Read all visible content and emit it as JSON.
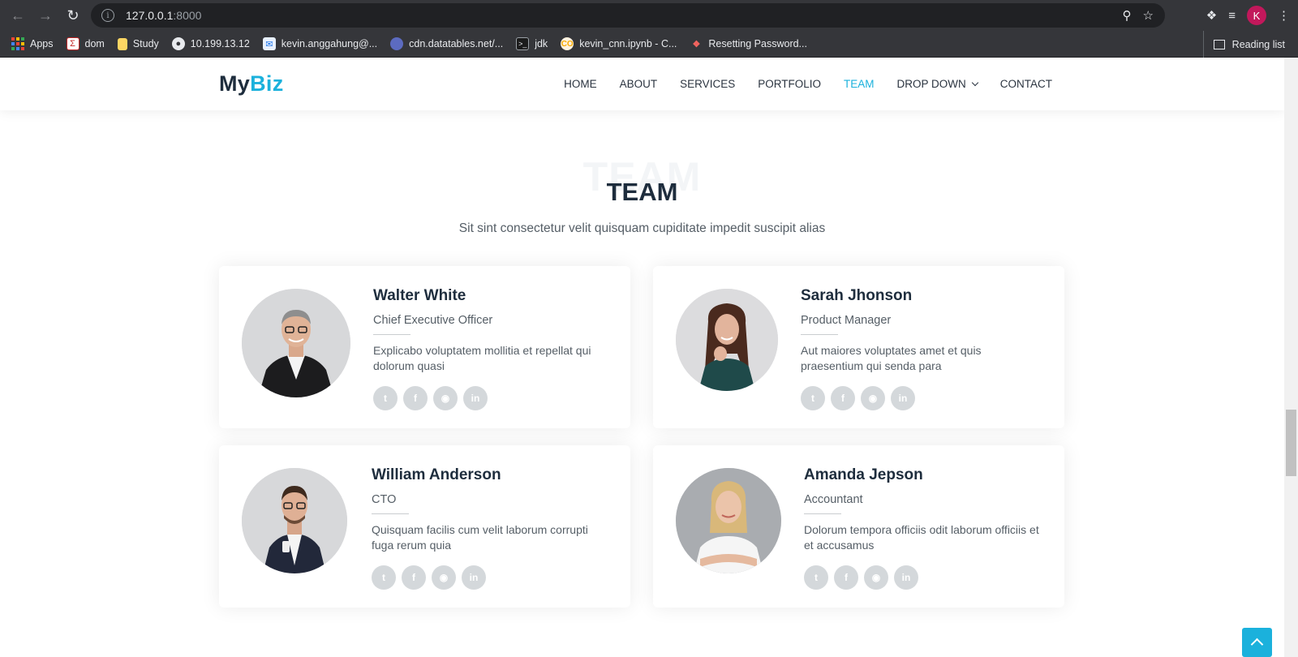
{
  "browser": {
    "url_host": "127.0.0.1",
    "url_port": ":8000",
    "profile_initial": "K",
    "bookmarks": [
      {
        "label": "Apps",
        "icon": "apps-grid-icon"
      },
      {
        "label": "dom",
        "icon": "sigma-icon"
      },
      {
        "label": "Study",
        "icon": "folder-icon"
      },
      {
        "label": "10.199.13.12",
        "icon": "globe-icon"
      },
      {
        "label": "kevin.anggahung@...",
        "icon": "mail-icon"
      },
      {
        "label": "cdn.datatables.net/...",
        "icon": "datatables-icon"
      },
      {
        "label": "jdk",
        "icon": "terminal-icon"
      },
      {
        "label": "kevin_cnn.ipynb - C...",
        "icon": "colab-icon"
      },
      {
        "label": "Resetting Password...",
        "icon": "laravel-icon"
      }
    ],
    "reading_list": "Reading list"
  },
  "site": {
    "logo_main": "My",
    "logo_accent": "Biz",
    "accent_color": "#1bb1dc",
    "nav": [
      {
        "label": "HOME"
      },
      {
        "label": "ABOUT"
      },
      {
        "label": "SERVICES"
      },
      {
        "label": "PORTFOLIO"
      },
      {
        "label": "TEAM",
        "active": true
      },
      {
        "label": "DROP DOWN",
        "dropdown": true
      },
      {
        "label": "CONTACT"
      }
    ]
  },
  "team": {
    "ghost_title": "TEAM",
    "title": "TEAM",
    "subtitle": "Sit sint consectetur velit quisquam cupiditate impedit suscipit alias",
    "members": [
      {
        "name": "Walter White",
        "role": "Chief Executive Officer",
        "description": "Explicabo voluptatem mollitia et repellat qui dolorum quasi"
      },
      {
        "name": "Sarah Jhonson",
        "role": "Product Manager",
        "description": "Aut maiores voluptates amet et quis praesentium qui senda para"
      },
      {
        "name": "William Anderson",
        "role": "CTO",
        "description": "Quisquam facilis cum velit laborum corrupti fuga rerum quia"
      },
      {
        "name": "Amanda Jepson",
        "role": "Accountant",
        "description": "Dolorum tempora officiis odit laborum officiis et et accusamus"
      }
    ],
    "social_icons": [
      "twitter-icon",
      "facebook-icon",
      "instagram-icon",
      "linkedin-icon"
    ]
  }
}
